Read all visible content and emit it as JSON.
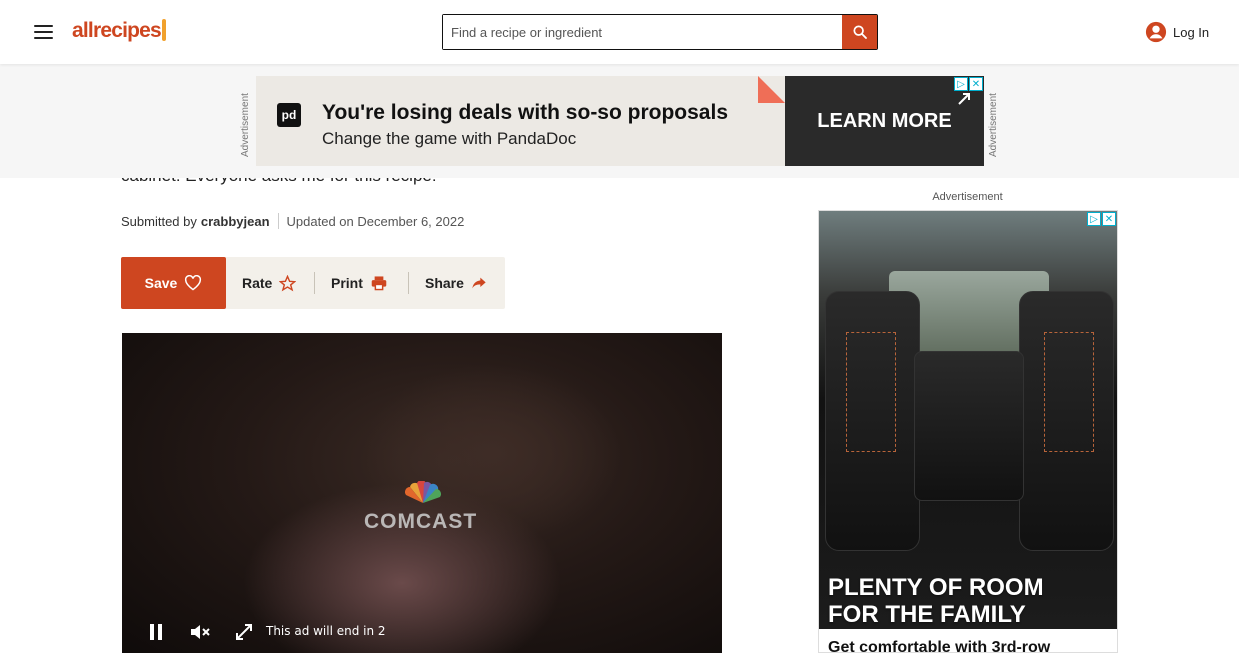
{
  "header": {
    "logo_text": "allrecipes",
    "search_placeholder": "Find a recipe or ingredient",
    "login_label": "Log In",
    "menu_icon": "menu-icon",
    "search_icon": "search-icon",
    "account_icon": "account-icon",
    "brand_color": "#ce4620"
  },
  "top_ad": {
    "label": "Advertisement",
    "logo_text": "pd",
    "title": "You're losing deals with so-so proposals",
    "subtitle": "Change the game with PandaDoc",
    "cta": "LEARN MORE"
  },
  "article": {
    "intro_text": "cabinet! Everyone asks me for this recipe!",
    "submitted_by_label": "Submitted by",
    "author": "crabbyjean",
    "updated": "Updated on December 6, 2022",
    "actions": {
      "save": "Save",
      "rate": "Rate",
      "print": "Print",
      "share": "Share"
    }
  },
  "video": {
    "brand": "COMCAST",
    "countdown": "This ad will end in 2"
  },
  "side_ad": {
    "label": "Advertisement",
    "title_line1": "PLENTY OF ROOM",
    "title_line2": "FOR THE FAMILY",
    "footer": "Get comfortable with 3rd-row"
  }
}
